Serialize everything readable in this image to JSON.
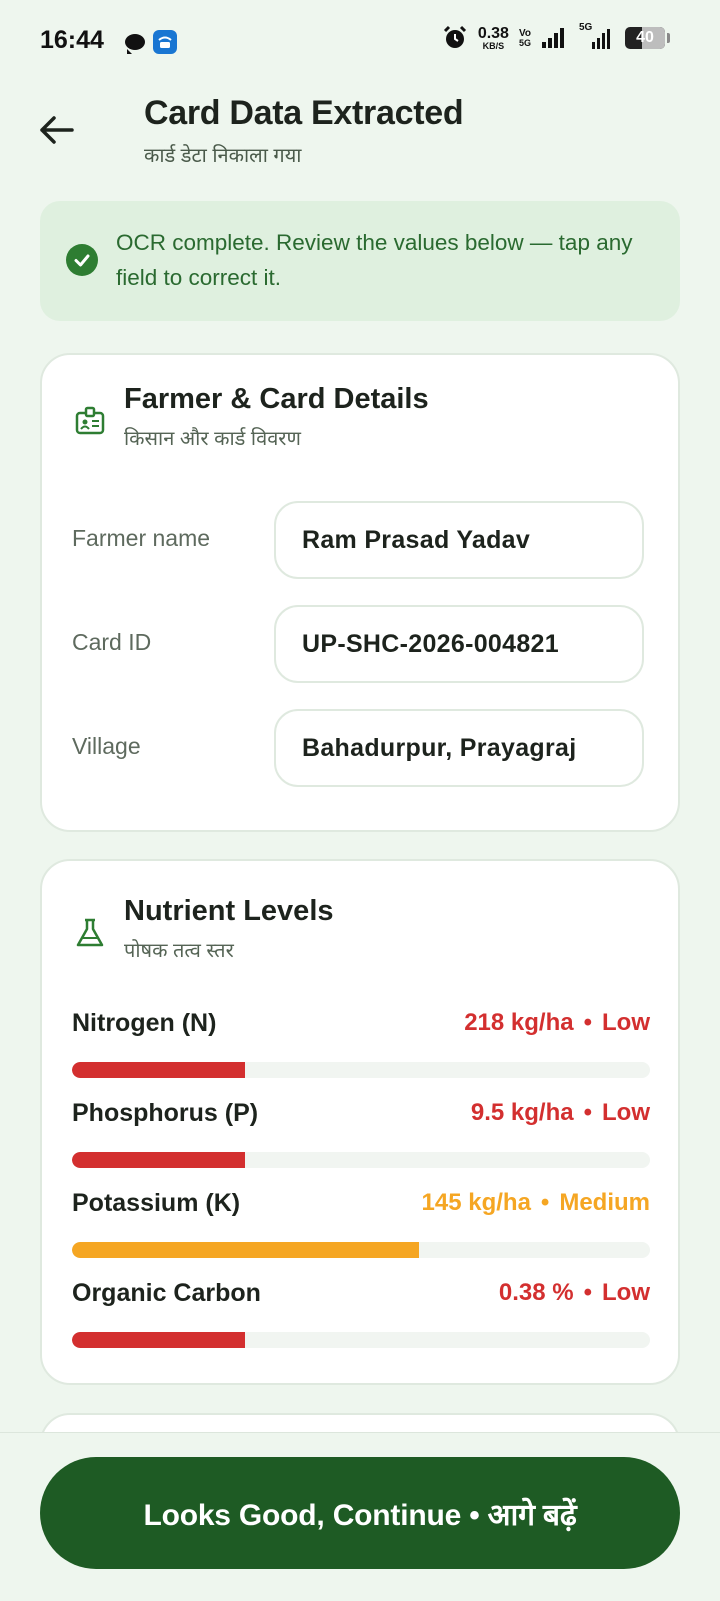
{
  "status_bar": {
    "time": "16:44",
    "net_speed": "0.38",
    "net_unit": "KB/S",
    "volte_top": "Vo",
    "volte_bottom": "5G",
    "fiveg_label": "5G",
    "battery_level": "40"
  },
  "header": {
    "title": "Card Data Extracted",
    "subtitle": "कार्ड डेटा निकाला गया"
  },
  "banner": {
    "text": "OCR complete. Review the values below — tap any field to correct it."
  },
  "farmer_card": {
    "title": "Farmer & Card Details",
    "subtitle": "किसान और कार्ड विवरण",
    "fields": [
      {
        "label": "Farmer name",
        "value": "Ram Prasad Yadav"
      },
      {
        "label": "Card ID",
        "value": "UP-SHC-2026-004821"
      },
      {
        "label": "Village",
        "value": "Bahadurpur, Prayagraj"
      }
    ]
  },
  "nutrient_card": {
    "title": "Nutrient Levels",
    "subtitle": "पोषक तत्व स्तर",
    "items": [
      {
        "name": "Nitrogen (N)",
        "value": "218 kg/ha",
        "status": "Low",
        "level": 0.3,
        "color": "#d32f2f"
      },
      {
        "name": "Phosphorus (P)",
        "value": "9.5 kg/ha",
        "status": "Low",
        "level": 0.3,
        "color": "#d32f2f"
      },
      {
        "name": "Potassium (K)",
        "value": "145 kg/ha",
        "status": "Medium",
        "level": 0.6,
        "color": "#f5a623"
      },
      {
        "name": "Organic Carbon",
        "value": "0.38 %",
        "status": "Low",
        "level": 0.3,
        "color": "#d32f2f"
      }
    ]
  },
  "actions": {
    "continue_label": "Looks Good, Continue • आगे बढ़ें"
  },
  "colors": {
    "primary": "#1e5b24",
    "low": "#d32f2f",
    "medium": "#f5a623",
    "background": "#eef6ee"
  }
}
